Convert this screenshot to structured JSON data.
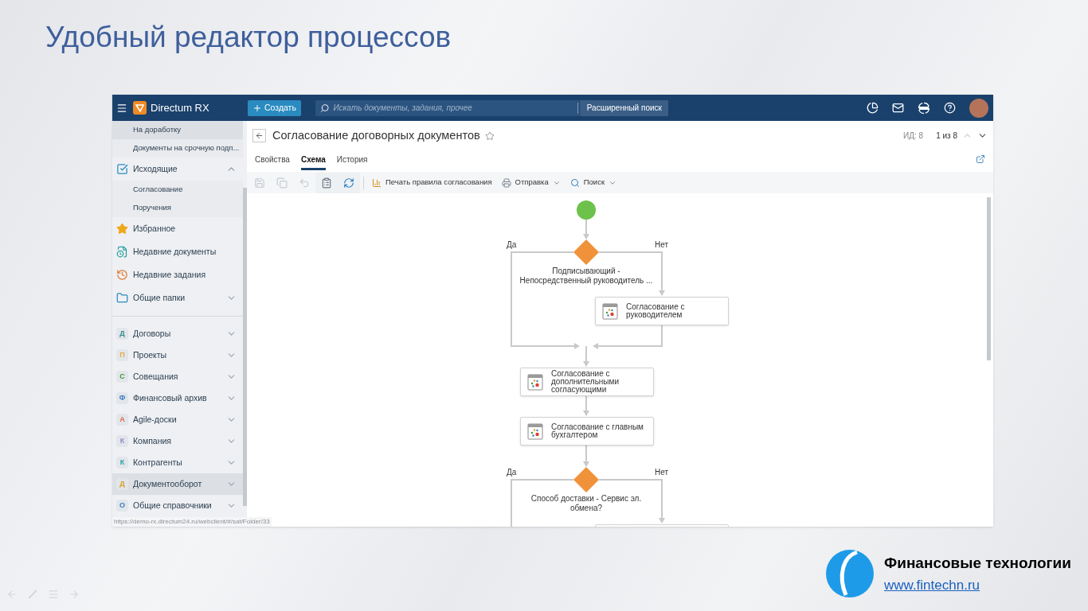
{
  "slide_title": "Удобный редактор процессов",
  "app": {
    "header": {
      "brand": "Directum RX",
      "create_button": "Создать",
      "search_placeholder": "Искать документы, задания, прочее",
      "advanced_search": "Расширенный поиск"
    },
    "sidebar": {
      "sections": [
        {
          "items": [
            {
              "kind": "sub",
              "label": "На доработку",
              "selected": true
            },
            {
              "kind": "sub",
              "label": "Документы на срочную подп...",
              "selected": false
            },
            {
              "kind": "outgoing",
              "label": "Исходящие",
              "selected": false,
              "expanded": true
            },
            {
              "kind": "sub",
              "label": "Согласование",
              "selected": false
            },
            {
              "kind": "sub",
              "label": "Поручения",
              "selected": false
            },
            {
              "kind": "star",
              "label": "Избранное",
              "selected": false
            },
            {
              "kind": "recent_docs",
              "label": "Недавние документы",
              "selected": false
            },
            {
              "kind": "recent_tasks",
              "label": "Недавние задания",
              "selected": false
            },
            {
              "kind": "folder",
              "label": "Общие папки",
              "selected": false,
              "expanded": false
            }
          ]
        },
        {
          "items": [
            {
              "kind": "module",
              "letter": "Д",
              "label": "Договоры",
              "color": "#2e8b8b",
              "selected": false,
              "expanded": false
            },
            {
              "kind": "module",
              "letter": "П",
              "label": "Проекты",
              "color": "#e8a93c",
              "selected": false,
              "expanded": false
            },
            {
              "kind": "module",
              "letter": "С",
              "label": "Совещания",
              "color": "#3a9a3a",
              "selected": false,
              "expanded": false
            },
            {
              "kind": "module",
              "letter": "Ф",
              "label": "Финансовый архив",
              "color": "#3a7fc0",
              "selected": false,
              "expanded": false
            },
            {
              "kind": "module",
              "letter": "А",
              "label": "Agile-доски",
              "color": "#e06a50",
              "selected": false,
              "expanded": false
            },
            {
              "kind": "module",
              "letter": "К",
              "label": "Компания",
              "color": "#9a8ac8",
              "selected": false,
              "expanded": false
            },
            {
              "kind": "module",
              "letter": "К",
              "label": "Контрагенты",
              "color": "#2aa0a0",
              "selected": false,
              "expanded": false
            },
            {
              "kind": "module",
              "letter": "Д",
              "label": "Документооборот",
              "color": "#d9a020",
              "selected": true,
              "expanded": false
            },
            {
              "kind": "module",
              "letter": "О",
              "label": "Общие справочники",
              "color": "#3a7fc0",
              "selected": false,
              "expanded": false
            }
          ]
        }
      ]
    },
    "document": {
      "title": "Согласование договорных документов",
      "id_label": "ИД: 8",
      "pager": "1 из 8",
      "tabs": [
        {
          "label": "Свойства",
          "selected": false
        },
        {
          "label": "Схема",
          "selected": true
        },
        {
          "label": "История",
          "selected": false
        }
      ],
      "toolbar": {
        "icon_buttons": [
          {
            "kind": "save",
            "disabled": true
          },
          {
            "kind": "copy",
            "disabled": true
          },
          {
            "kind": "undo",
            "disabled": true
          },
          {
            "kind": "clipboard",
            "disabled": false
          },
          {
            "kind": "refresh",
            "disabled": false
          }
        ],
        "buttons": [
          {
            "kind": "print",
            "label": "Печать правила согласования",
            "dropdown": false
          },
          {
            "kind": "send",
            "label": "Отправка",
            "dropdown": true
          },
          {
            "kind": "search",
            "label": "Поиск",
            "dropdown": true
          }
        ]
      }
    },
    "diagram": {
      "nodes": [
        {
          "kind": "start"
        },
        {
          "kind": "condition",
          "text": "Подписывающий - Непосредственный руководитель ...",
          "yes": "Да",
          "no": "Нет"
        },
        {
          "kind": "task",
          "text": "Согласование с руководителем"
        },
        {
          "kind": "task",
          "text": "Согласование с дополнительными согласующими"
        },
        {
          "kind": "task",
          "text": "Согласование с главным бухгалтером"
        },
        {
          "kind": "condition",
          "text": "Способ доставки - Сервис эл. обмена?",
          "yes": "Да",
          "no": "Нет"
        }
      ]
    },
    "status_url": "https://demo-rx.directum24.ru/webclient/#/sat/Folder/33"
  },
  "footer": {
    "company": "Финансовые технологии",
    "link": "www.fintechn.ru"
  }
}
